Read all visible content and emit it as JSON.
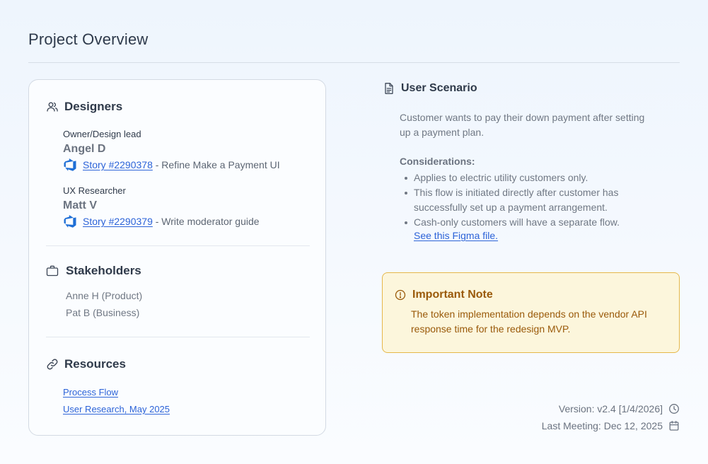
{
  "page": {
    "title": "Project Overview"
  },
  "designers": {
    "heading": "Designers",
    "members": [
      {
        "role": "Owner/Design lead",
        "name": "Angel D",
        "story_link": "Story #2290378",
        "story_desc": " - Refine Make a Payment UI"
      },
      {
        "role": "UX Researcher",
        "name": "Matt V",
        "story_link": "Story #2290379",
        "story_desc": " - Write moderator guide"
      }
    ]
  },
  "stakeholders": {
    "heading": "Stakeholders",
    "items": [
      "Anne H (Product)",
      "Pat B (Business)"
    ]
  },
  "resources": {
    "heading": "Resources",
    "links": [
      "Process Flow",
      "User Research, May 2025"
    ]
  },
  "scenario": {
    "heading": "User Scenario",
    "text": "Customer wants to pay their down payment after setting up a payment plan.",
    "considerations_title": "Considerations:",
    "considerations": [
      "Applies to electric utility customers only.",
      "This flow is initiated directly after customer has successfully set up a payment arrangement.",
      "Cash-only customers will have a separate flow."
    ],
    "figma_link": "See this Figma file."
  },
  "note": {
    "heading": "Important Note",
    "text": "The token implementation depends on the vendor API response time for the redesign MVP."
  },
  "meta": {
    "version": "Version: v2.4 [1/4/2026]",
    "last_meeting": "Last Meeting: Dec 12, 2025"
  },
  "icons": {
    "designers": "users-icon",
    "stakeholders": "briefcase-icon",
    "resources": "link-icon",
    "scenario": "document-icon",
    "note": "info-circle-icon",
    "version": "clock-icon",
    "meeting": "calendar-icon",
    "story": "azure-devops-icon"
  },
  "colors": {
    "link": "#2c63d8",
    "note_bg": "#fcf6dc",
    "note_border": "#e6b84a",
    "note_text": "#9a5a0a",
    "devops_icon": "#1f6fd6"
  }
}
